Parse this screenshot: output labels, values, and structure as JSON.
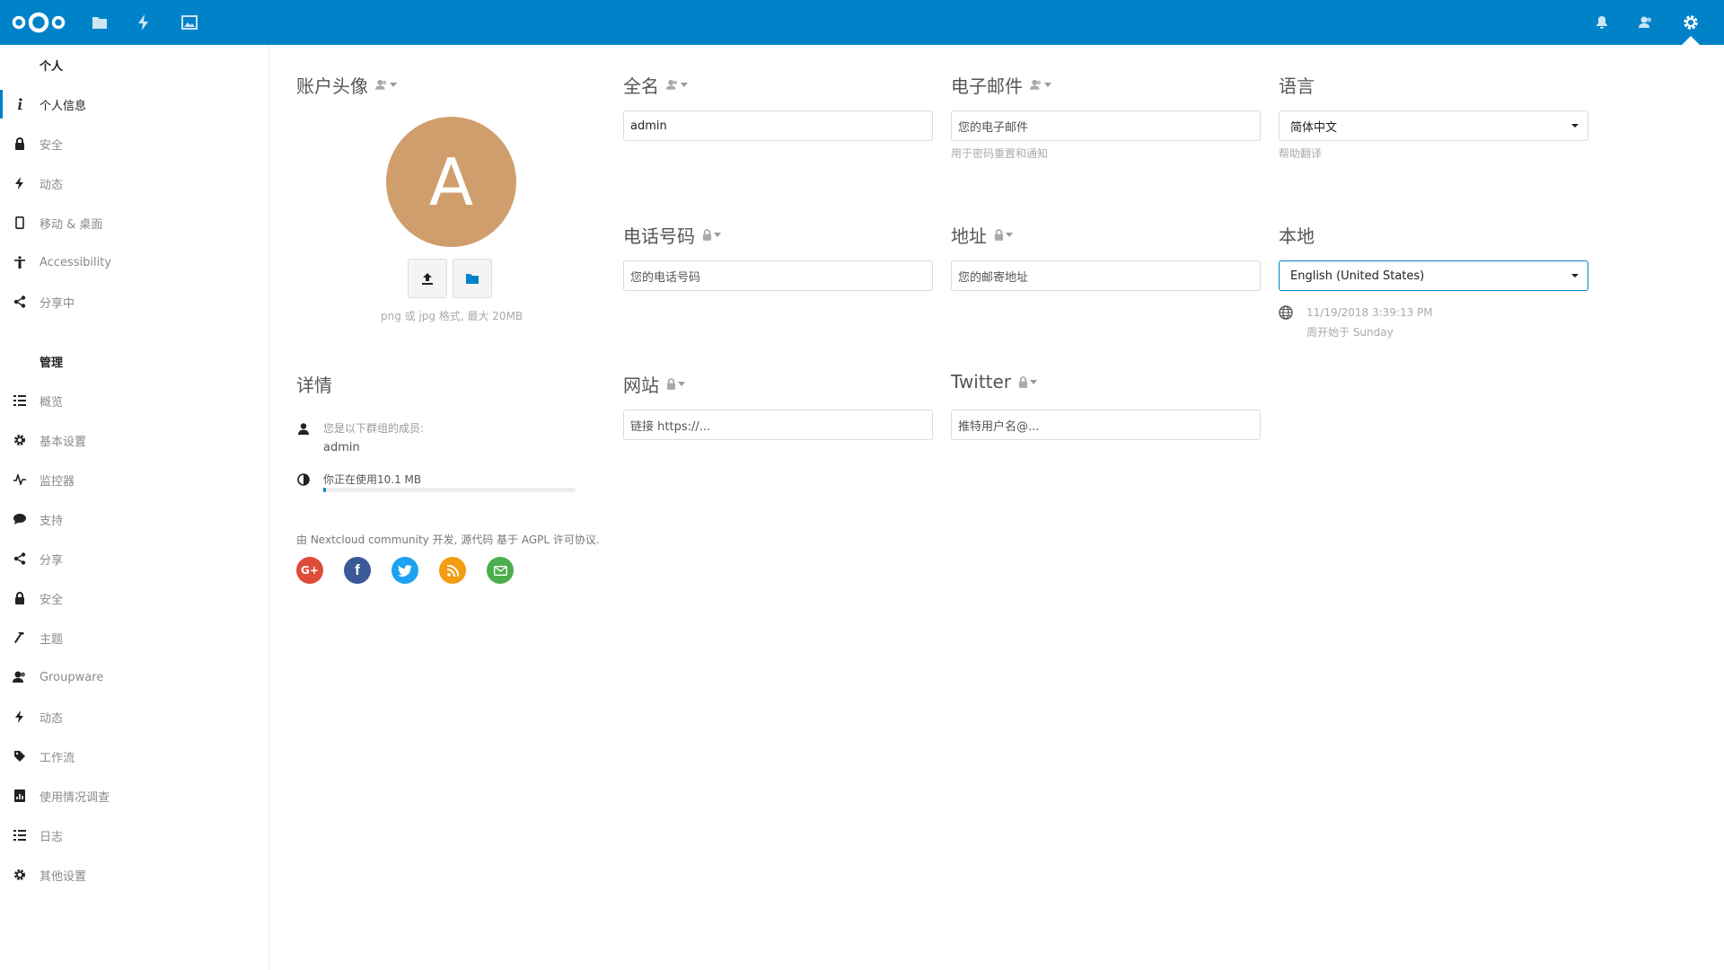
{
  "sidebar": {
    "personal_heading": "个人",
    "personal_items": [
      {
        "label": "个人信息",
        "icon": "info-icon"
      },
      {
        "label": "安全",
        "icon": "lock-icon"
      },
      {
        "label": "动态",
        "icon": "lightning-icon"
      },
      {
        "label": "移动 & 桌面",
        "icon": "phone-icon"
      },
      {
        "label": "Accessibility",
        "icon": "accessibility-icon"
      },
      {
        "label": "分享中",
        "icon": "share-icon"
      }
    ],
    "admin_heading": "管理",
    "admin_items": [
      {
        "label": "概览",
        "icon": "list-icon"
      },
      {
        "label": "基本设置",
        "icon": "gear-icon"
      },
      {
        "label": "监控器",
        "icon": "pulse-icon"
      },
      {
        "label": "支持",
        "icon": "chat-bubble-icon"
      },
      {
        "label": "分享",
        "icon": "share-icon"
      },
      {
        "label": "安全",
        "icon": "lock-icon"
      },
      {
        "label": "主题",
        "icon": "hammer-icon"
      },
      {
        "label": "Groupware",
        "icon": "contacts-icon"
      },
      {
        "label": "动态",
        "icon": "lightning-icon"
      },
      {
        "label": "工作流",
        "icon": "tag-icon"
      },
      {
        "label": "使用情况调查",
        "icon": "report-icon"
      },
      {
        "label": "日志",
        "icon": "list-icon"
      },
      {
        "label": "其他设置",
        "icon": "gear-icon"
      }
    ]
  },
  "avatar": {
    "title": "账户头像",
    "initial": "A",
    "color": "#d09e6d",
    "hint": "png 或 jpg 格式, 最大 20MB"
  },
  "fullname": {
    "title": "全名",
    "value": "admin"
  },
  "email": {
    "title": "电子邮件",
    "placeholder": "您的电子邮件",
    "hint": "用于密码重置和通知"
  },
  "language": {
    "title": "语言",
    "value": "简体中文",
    "hint": "帮助翻译"
  },
  "phone": {
    "title": "电话号码",
    "placeholder": "您的电话号码"
  },
  "address": {
    "title": "地址",
    "placeholder": "您的邮寄地址"
  },
  "locale": {
    "title": "本地",
    "value": "English (United States)",
    "datetime": "11/19/2018 3:39:13 PM",
    "week_start": "周开始于 Sunday"
  },
  "details": {
    "title": "详情",
    "groups_label": "您是以下群组的成员:",
    "group": "admin",
    "quota_text": "你正在使用10.1 MB",
    "quota_fraction": 0.01
  },
  "website": {
    "title": "网站",
    "placeholder": "链接 https://..."
  },
  "twitter": {
    "title": "Twitter",
    "placeholder": "推特用户名@..."
  },
  "footer": {
    "text": "由 Nextcloud community 开发, 源代码 基于 AGPL 许可协议."
  },
  "colors": {
    "brand": "#0082c9",
    "google": "#dd4b39",
    "facebook": "#3b5998",
    "twitter": "#1da1f2",
    "rss": "#f39c12",
    "mail": "#4cae4c"
  }
}
